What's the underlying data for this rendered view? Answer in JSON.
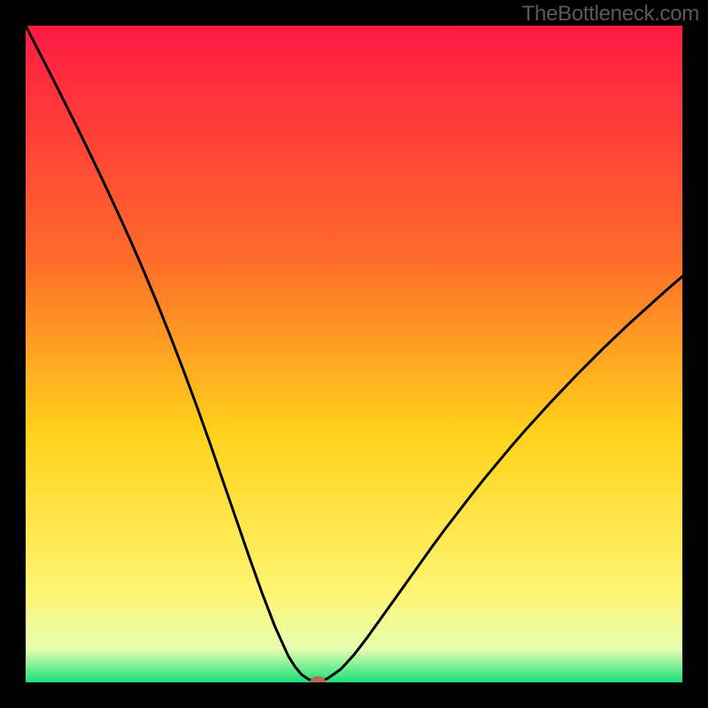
{
  "watermark": "TheBottleneck.com",
  "colors": {
    "frame": "#000000",
    "watermark": "#5a5a5a",
    "gradient_top": "#ff1a44",
    "gradient_mid1": "#ff6a2a",
    "gradient_mid2": "#ffd21a",
    "gradient_mid3": "#fff470",
    "gradient_mid4": "#e6ffb0",
    "gradient_bottom": "#18e07a",
    "curve": "#000000",
    "marker": "#b76a5a"
  },
  "chart_data": {
    "type": "line",
    "title": "",
    "xlabel": "",
    "ylabel": "",
    "xlim": [
      0,
      100
    ],
    "ylim": [
      0,
      100
    ],
    "x": [
      0,
      2,
      4,
      6,
      8,
      10,
      12,
      14,
      16,
      18,
      20,
      22,
      24,
      26,
      28,
      30,
      32,
      34,
      36,
      38,
      40,
      41,
      42,
      43,
      44,
      44.5,
      45,
      46,
      48,
      50,
      52,
      54,
      56,
      58,
      60,
      62,
      64,
      66,
      68,
      70,
      72,
      74,
      76,
      78,
      80,
      82,
      84,
      86,
      88,
      90,
      92,
      94,
      96,
      98,
      100
    ],
    "y": [
      100,
      96.1,
      92.2,
      88.2,
      84.2,
      80.1,
      75.9,
      71.6,
      67.2,
      62.6,
      57.8,
      52.8,
      47.6,
      42.2,
      36.6,
      30.8,
      25.0,
      19.2,
      13.6,
      8.4,
      4.0,
      2.4,
      1.2,
      0.5,
      0.1,
      0,
      0.2,
      0.6,
      2.0,
      4.2,
      6.8,
      9.6,
      12.4,
      15.2,
      18.0,
      20.8,
      23.5,
      26.1,
      28.7,
      31.2,
      33.6,
      36.0,
      38.3,
      40.5,
      42.7,
      44.8,
      46.9,
      48.9,
      50.9,
      52.8,
      54.7,
      56.5,
      58.3,
      60.1,
      61.8
    ],
    "marker": {
      "x": 44.5,
      "y": 0
    },
    "annotations": []
  }
}
